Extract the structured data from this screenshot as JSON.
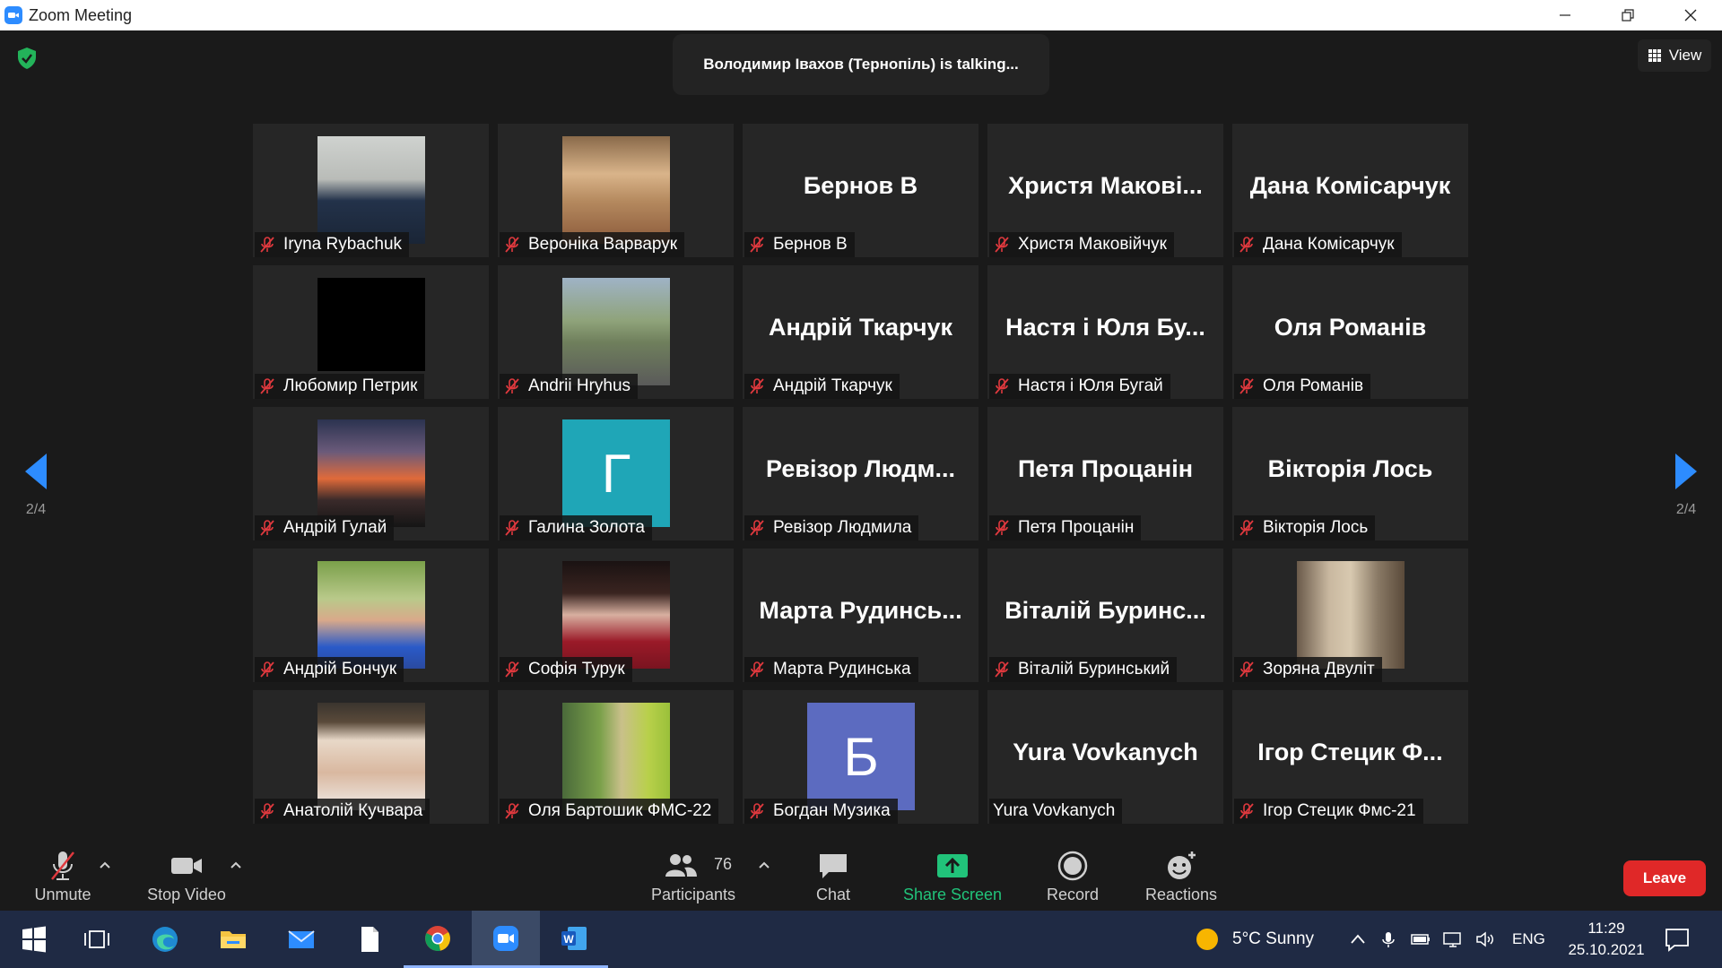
{
  "window": {
    "title": "Zoom Meeting"
  },
  "meeting": {
    "talking_text": "Володимир Івахов (Тернопіль) is talking...",
    "view_label": "View",
    "page_indicator_left": "2/4",
    "page_indicator_right": "2/4"
  },
  "tiles": [
    {
      "label": "Iryna Rybachuk"
    },
    {
      "label": "Вероніка Варварук"
    },
    {
      "label": "Бернов В",
      "big": "Бернов В"
    },
    {
      "label": "Христя Маковійчук",
      "big": "Христя  Макові..."
    },
    {
      "label": "Дана Комісарчук",
      "big": "Дана Комісарчук"
    },
    {
      "label": "Любомир Петрик"
    },
    {
      "label": "Andrii Hryhus"
    },
    {
      "label": "Андрій Ткарчук",
      "big": "Андрій Ткарчук"
    },
    {
      "label": "Настя і Юля Бугай",
      "big": "Настя і Юля Бу..."
    },
    {
      "label": "Оля Романів",
      "big": "Оля Романів"
    },
    {
      "label": "Андрій Гулай"
    },
    {
      "label": "Галина Золота",
      "avatar_letter": "Г",
      "avatar_color": "#1fa6b7"
    },
    {
      "label": "Ревізор Людмила",
      "big": "Ревізор  Людм..."
    },
    {
      "label": "Петя Процанін",
      "big": "Петя Процанін"
    },
    {
      "label": "Вікторія Лось",
      "big": "Вікторія Лось"
    },
    {
      "label": "Андрій Бончук"
    },
    {
      "label": "Софія Турук"
    },
    {
      "label": "Марта Рудинська",
      "big": "Марта  Рудинсь..."
    },
    {
      "label": "Віталій Буринський",
      "big": "Віталій  Буринс..."
    },
    {
      "label": "Зоряна Двуліт"
    },
    {
      "label": "Анатолій Кучвара"
    },
    {
      "label": "Оля Бартошик ФМС-22"
    },
    {
      "label": "Богдан Музика",
      "avatar_letter": "Б",
      "avatar_color": "#5c6bc0"
    },
    {
      "label": "Yura Vovkanych",
      "big": "Yura Vovkanych"
    },
    {
      "label": "Ігор Стецик Фмс-21",
      "big": "Ігор  Стецик  Ф..."
    }
  ],
  "toolbar": {
    "unmute": "Unmute",
    "stop_video": "Stop Video",
    "participants": "Participants",
    "participants_count": "76",
    "chat": "Chat",
    "share_screen": "Share Screen",
    "record": "Record",
    "reactions": "Reactions",
    "leave": "Leave"
  },
  "taskbar": {
    "weather": "5°C  Sunny",
    "language": "ENG",
    "time": "11:29",
    "date": "25.10.2021"
  },
  "colors": {
    "accent_blue": "#2d8cff",
    "share_green": "#21c37a",
    "leave_red": "#e02828",
    "muted_red": "#e0393e"
  }
}
